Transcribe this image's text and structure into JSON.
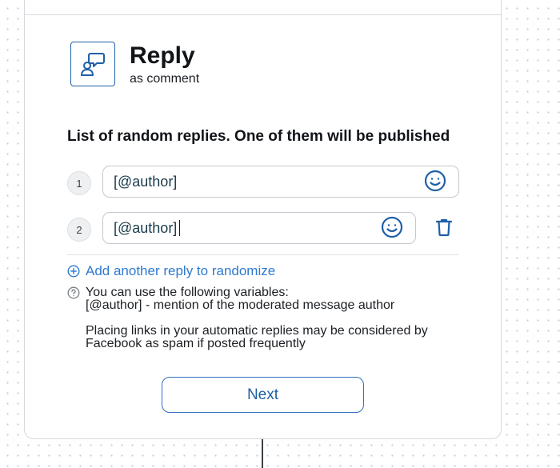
{
  "header": {
    "title": "Reply",
    "subtitle": "as comment",
    "icon": "reply-comment-icon"
  },
  "section_title": "List of random replies. One of them will be published",
  "replies": [
    {
      "number": "1",
      "value": "[@author]"
    },
    {
      "number": "2",
      "value": "[@author]"
    }
  ],
  "add_reply_label": "Add another reply to randomize",
  "help": {
    "line1": "You can use the following variables:",
    "line2": "[@author] - mention of the moderated message author",
    "line3": "Placing links in your automatic replies may be considered by",
    "line4": "Facebook as spam if posted frequently"
  },
  "next_label": "Next",
  "colors": {
    "accent": "#1f5fa8",
    "link": "#2f7ad1",
    "border": "#d5d9de"
  }
}
